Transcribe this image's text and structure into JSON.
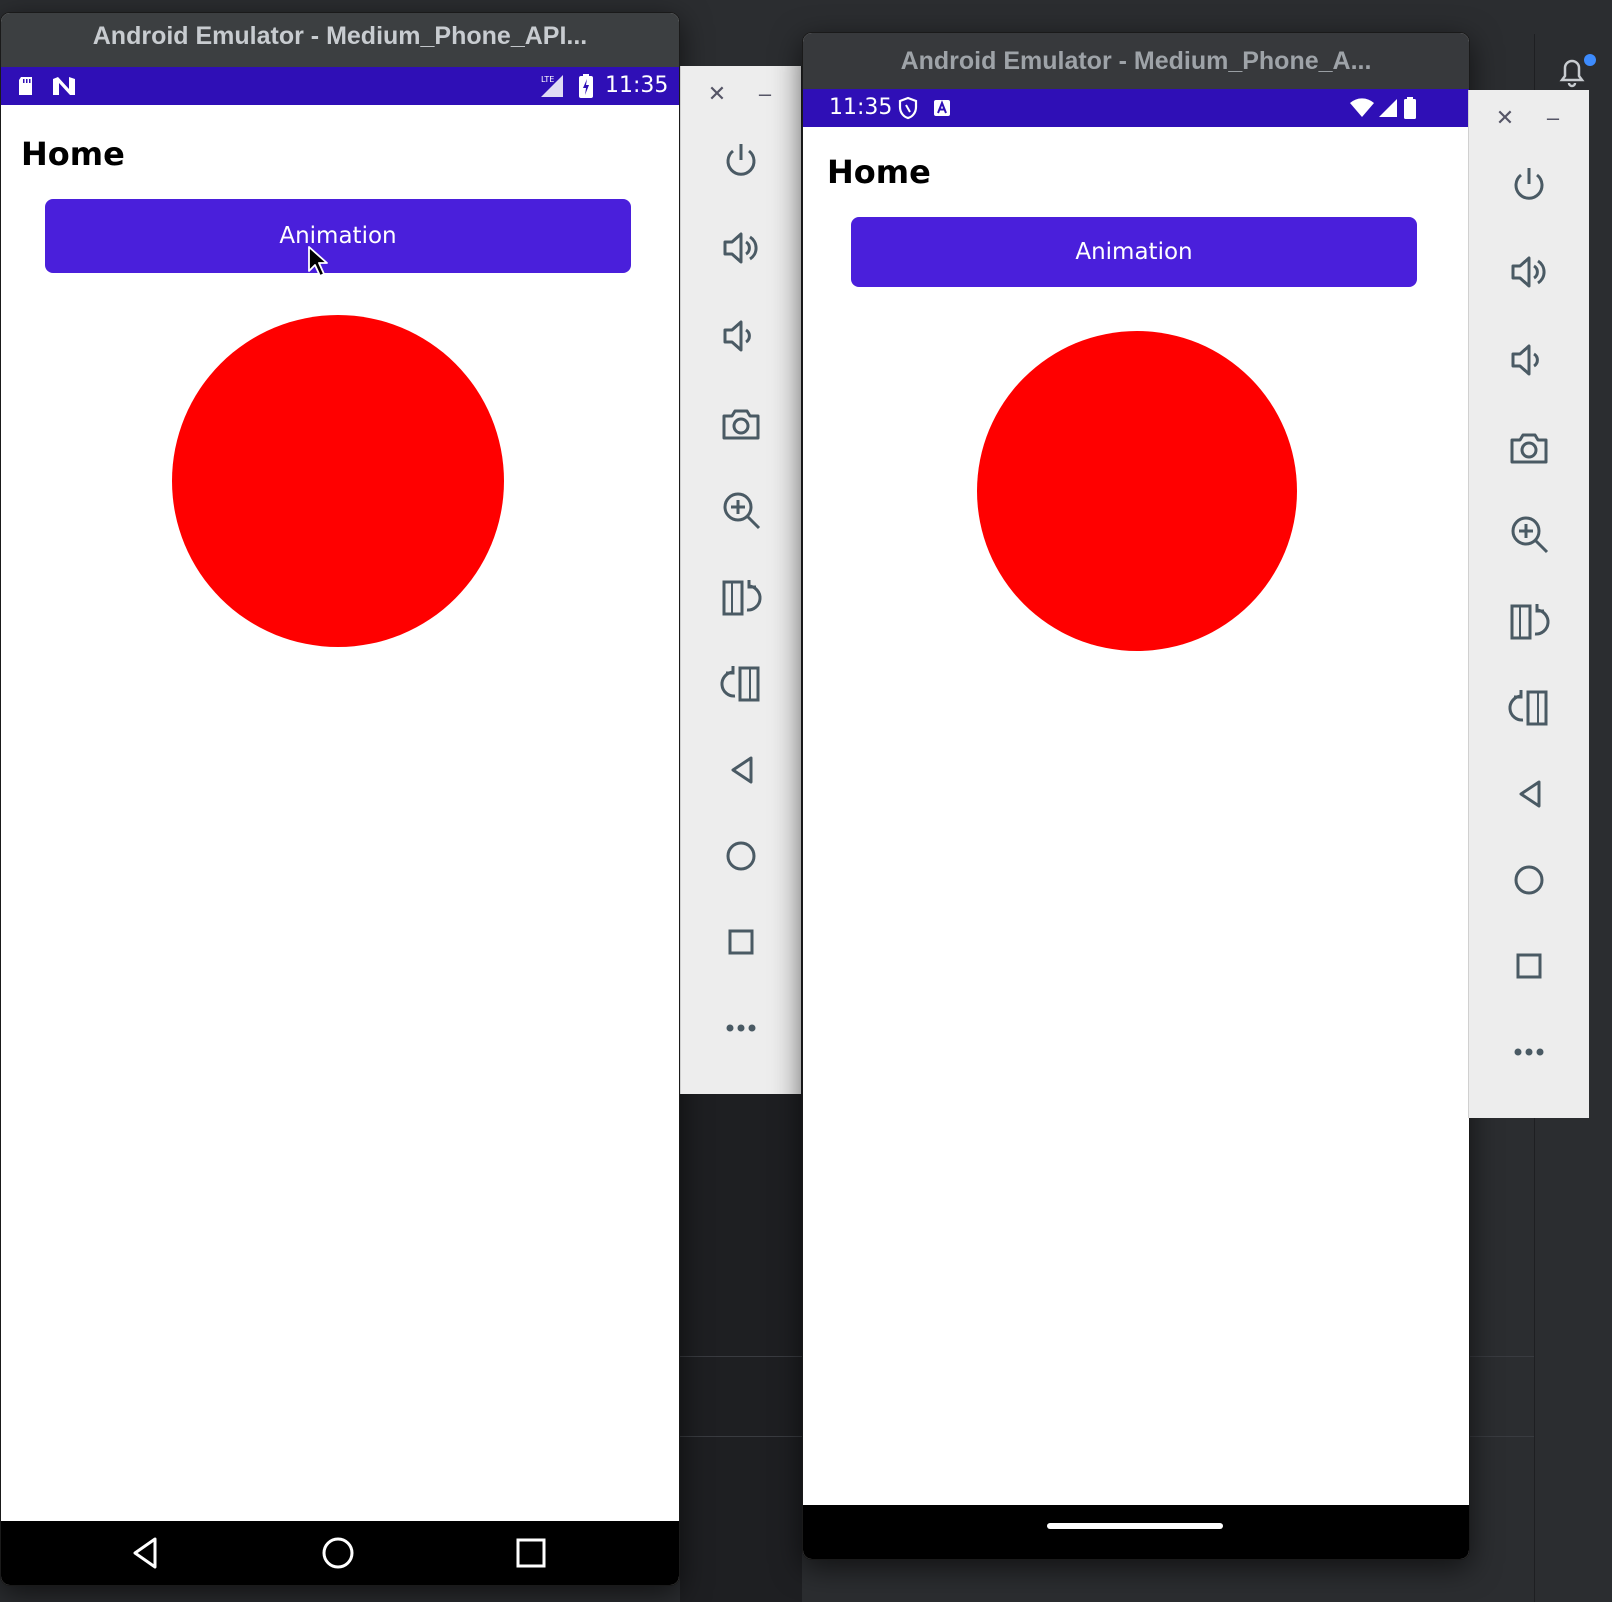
{
  "colors": {
    "statusbar": "#2f0fb6",
    "button": "#4a1fdb",
    "circle": "#ff0000",
    "toolbar_bg": "#ededed",
    "icon": "#4a5a64"
  },
  "emulator_left": {
    "title": "Android Emulator - Medium_Phone_API...",
    "status": {
      "time": "11:35",
      "icons": [
        "sd-card-icon",
        "n-logo-icon",
        "lte-signal-icon",
        "battery-charging-icon"
      ]
    },
    "page_title": "Home",
    "button_label": "Animation",
    "nav": [
      "back-icon",
      "home-icon",
      "recents-icon"
    ]
  },
  "emulator_right": {
    "title": "Android Emulator - Medium_Phone_A...",
    "status": {
      "time": "11:35",
      "icons": [
        "shield-icon",
        "a-icon",
        "wifi-icon",
        "signal-icon",
        "battery-icon"
      ]
    },
    "page_title": "Home",
    "button_label": "Animation",
    "nav": [
      "gesture-bar"
    ]
  },
  "toolbar": {
    "close": "✕",
    "minimize": "–",
    "tools": [
      "power-icon",
      "volume-up-icon",
      "volume-down-icon",
      "camera-icon",
      "zoom-icon",
      "rotate-left-icon",
      "rotate-right-icon",
      "back-icon",
      "home-icon",
      "overview-icon",
      "more-icon"
    ]
  }
}
